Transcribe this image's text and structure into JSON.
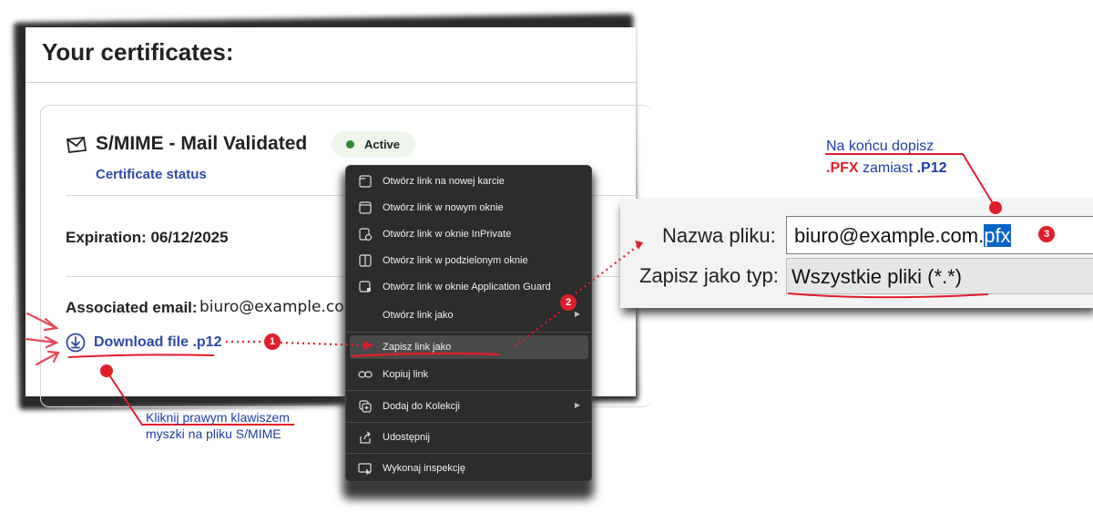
{
  "panel": {
    "title": "Your certificates:",
    "cert_name": "S/MIME - Mail Validated",
    "status_badge": "Active",
    "status_link": "Certificate status",
    "expiration": "Expiration: 06/12/2025",
    "assoc_label": "Associated email:",
    "assoc_value": "biuro@example.com",
    "download_label": "Download file .p12"
  },
  "menu": {
    "items": [
      {
        "label": "Otwórz link na nowej karcie",
        "icon": "new-tab-icon"
      },
      {
        "label": "Otwórz link w nowym oknie",
        "icon": "new-window-icon"
      },
      {
        "label": "Otwórz link w oknie InPrivate",
        "icon": "inprivate-icon"
      },
      {
        "label": "Otwórz link w podzielonym oknie",
        "icon": "split-window-icon"
      },
      {
        "label": "Otwórz link w oknie Application Guard",
        "icon": "application-guard-icon"
      },
      {
        "label": "Otwórz link jako",
        "icon": "none"
      },
      {
        "label": "Zapisz link jako",
        "icon": "none"
      },
      {
        "label": "Kopiuj link",
        "icon": "link-icon"
      },
      {
        "label": "Dodaj do Kolekcji",
        "icon": "collections-icon"
      },
      {
        "label": "Udostępnij",
        "icon": "share-icon"
      },
      {
        "label": "Wykonaj inspekcję",
        "icon": "inspect-icon"
      }
    ]
  },
  "dialog": {
    "filename_label": "Nazwa pliku:",
    "filename_value_base": "biuro@example.com.",
    "filename_value_ext": "pfx",
    "filetype_label": "Zapisz jako typ:",
    "filetype_value": "Wszystkie pliki (*.*)"
  },
  "annotations": {
    "step1": "1",
    "step2": "2",
    "step3": "3",
    "note_left_line1": "Kliknij prawym klawiszem",
    "note_left_line2": "myszki na pliku S/MIME",
    "note_right_line1": "Na końcu dopisz",
    "note_right_pfx": ".PFX",
    "note_right_mid": " zamiast ",
    "note_right_p12": ".P12"
  },
  "colors": {
    "accent_red": "#e01e2a",
    "link_blue": "#2d4aa8",
    "menu_bg": "#2c2c2c",
    "active_green": "#2f8a2f",
    "selection_blue": "#0a64c8"
  }
}
